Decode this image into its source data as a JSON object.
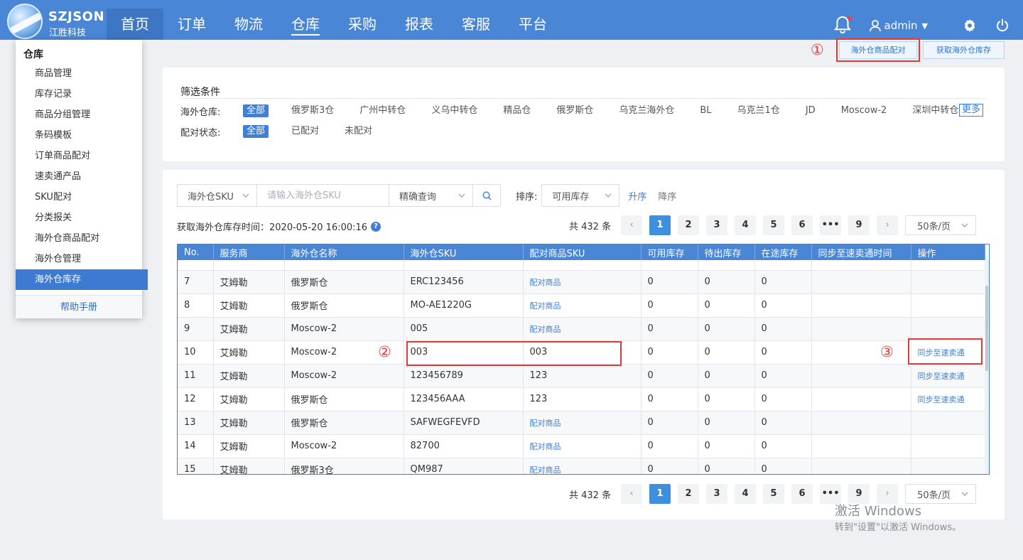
{
  "brand": {
    "name_en": "SZJSON",
    "name_cn": "江胜科技"
  },
  "nav": [
    "首页",
    "订单",
    "物流",
    "仓库",
    "采购",
    "报表",
    "客服",
    "平台"
  ],
  "user": {
    "name": "admin"
  },
  "menu": {
    "title": "仓库",
    "items": [
      "商品管理",
      "库存记录",
      "商品分组管理",
      "条码模板",
      "订单商品配对",
      "速卖通产品",
      "SKU配对",
      "分类报关",
      "海外仓商品配对",
      "海外仓管理",
      "海外仓库存"
    ],
    "help": "帮助手册"
  },
  "actions": {
    "pair_btn": "海外仓商品配对",
    "fetch_btn": "获取海外仓库存"
  },
  "annotations": {
    "one": "①",
    "two": "②",
    "three": "③"
  },
  "filter": {
    "title": "筛选条件",
    "warehouse_label": "海外仓库:",
    "warehouses": [
      "全部",
      "俄罗斯3仓",
      "广州中转仓",
      "义乌中转仓",
      "精品仓",
      "俄罗斯仓",
      "乌克兰海外仓",
      "BL",
      "乌克兰1仓",
      "JD",
      "Moscow-2",
      "深圳中转仓"
    ],
    "more": "更多",
    "status_label": "配对状态:",
    "statuses": [
      "全部",
      "已配对",
      "未配对"
    ]
  },
  "search": {
    "field": "海外仓SKU",
    "placeholder": "请输入海外仓SKU",
    "mode": "精确查询",
    "sort_label": "排序:",
    "sort_field": "可用库存",
    "asc": "升序",
    "desc": "降序"
  },
  "fetch_time": "获取海外仓库存时间：2020-05-20 16:00:16",
  "pager": {
    "total": "共 432 条",
    "prev": "‹",
    "pages": [
      "1",
      "2",
      "3",
      "4",
      "5",
      "6",
      "•••",
      "9"
    ],
    "next": "›",
    "size": "50条/页"
  },
  "table": {
    "headers": [
      "No.",
      "服务商",
      "海外仓名称",
      "海外仓SKU",
      "配对商品SKU",
      "可用库存",
      "待出库存",
      "在途库存",
      "同步至速卖通时间",
      "操作"
    ],
    "rows": [
      [
        "7",
        "艾姆勒",
        "俄罗斯仓",
        "ERC123456",
        "配对商品",
        "0",
        "0",
        "0",
        "",
        ""
      ],
      [
        "8",
        "艾姆勒",
        "俄罗斯仓",
        "MO-AE1220G",
        "配对商品",
        "0",
        "0",
        "0",
        "",
        ""
      ],
      [
        "9",
        "艾姆勒",
        "Moscow-2",
        "005",
        "配对商品",
        "0",
        "0",
        "0",
        "",
        ""
      ],
      [
        "10",
        "艾姆勒",
        "Moscow-2",
        "003",
        "003",
        "0",
        "0",
        "0",
        "",
        "同步至速卖通"
      ],
      [
        "11",
        "艾姆勒",
        "Moscow-2",
        "123456789",
        "123",
        "0",
        "0",
        "0",
        "",
        "同步至速卖通"
      ],
      [
        "12",
        "艾姆勒",
        "俄罗斯仓",
        "123456AAA",
        "123",
        "0",
        "0",
        "0",
        "",
        "同步至速卖通"
      ],
      [
        "13",
        "艾姆勒",
        "俄罗斯仓",
        "SAFWEGFEVFD",
        "配对商品",
        "0",
        "0",
        "0",
        "",
        ""
      ],
      [
        "14",
        "艾姆勒",
        "Moscow-2",
        "82700",
        "配对商品",
        "0",
        "0",
        "0",
        "",
        ""
      ],
      [
        "15",
        "艾姆勒",
        "俄罗斯3仓",
        "QM987",
        "配对商品",
        "0",
        "0",
        "0",
        "",
        ""
      ]
    ]
  },
  "watermark": {
    "line1": "激活 Windows",
    "line2": "转到\"设置\"以激活 Windows。"
  },
  "colors": {
    "primary": "#4a86d6",
    "accent": "#3f7fd6",
    "highlight": "#e53935"
  }
}
